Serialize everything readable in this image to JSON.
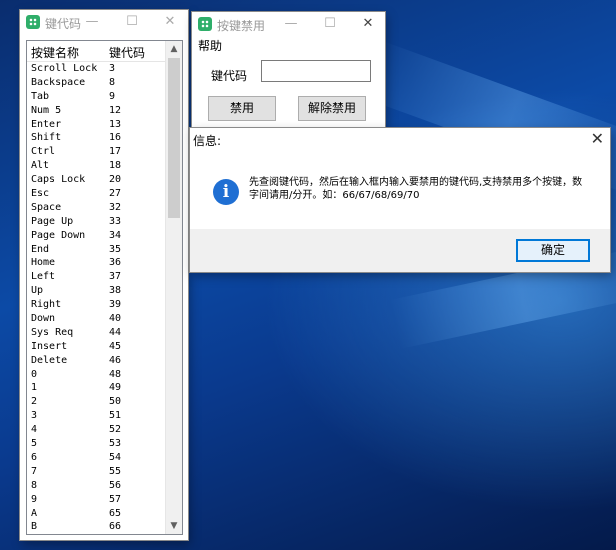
{
  "codes_window": {
    "title": "键代码",
    "minimize": "—",
    "maximize": "☐",
    "close": "✕",
    "columns": {
      "name": "按键名称",
      "code": "键代码"
    },
    "rows": [
      {
        "name": "Scroll Lock",
        "code": "3"
      },
      {
        "name": "Backspace",
        "code": "8"
      },
      {
        "name": "Tab",
        "code": "9"
      },
      {
        "name": "Num 5",
        "code": "12"
      },
      {
        "name": "Enter",
        "code": "13"
      },
      {
        "name": "Shift",
        "code": "16"
      },
      {
        "name": "Ctrl",
        "code": "17"
      },
      {
        "name": "Alt",
        "code": "18"
      },
      {
        "name": "Caps Lock",
        "code": "20"
      },
      {
        "name": "Esc",
        "code": "27"
      },
      {
        "name": "Space",
        "code": "32"
      },
      {
        "name": "Page Up",
        "code": "33"
      },
      {
        "name": "Page Down",
        "code": "34"
      },
      {
        "name": "End",
        "code": "35"
      },
      {
        "name": "Home",
        "code": "36"
      },
      {
        "name": "Left",
        "code": "37"
      },
      {
        "name": "Up",
        "code": "38"
      },
      {
        "name": "Right",
        "code": "39"
      },
      {
        "name": "Down",
        "code": "40"
      },
      {
        "name": "Sys Req",
        "code": "44"
      },
      {
        "name": "Insert",
        "code": "45"
      },
      {
        "name": "Delete",
        "code": "46"
      },
      {
        "name": "0",
        "code": "48"
      },
      {
        "name": "1",
        "code": "49"
      },
      {
        "name": "2",
        "code": "50"
      },
      {
        "name": "3",
        "code": "51"
      },
      {
        "name": "4",
        "code": "52"
      },
      {
        "name": "5",
        "code": "53"
      },
      {
        "name": "6",
        "code": "54"
      },
      {
        "name": "7",
        "code": "55"
      },
      {
        "name": "8",
        "code": "56"
      },
      {
        "name": "9",
        "code": "57"
      },
      {
        "name": "A",
        "code": "65"
      },
      {
        "name": "B",
        "code": "66"
      }
    ],
    "scroll_up": "▲",
    "scroll_down": "▼"
  },
  "block_window": {
    "title": "按键禁用",
    "minimize": "—",
    "maximize": "☐",
    "close": "✕",
    "menu_help": "帮助",
    "code_label": "键代码",
    "code_value": "",
    "disable_label": "禁用",
    "enable_label": "解除禁用"
  },
  "message_box": {
    "title": "信息:",
    "close": "✕",
    "icon_glyph": "i",
    "text": "先查阅键代码，然后在输入框内输入要禁用的键代码,支持禁用多个按键，数字间请用/分开。如：66/67/68/69/70",
    "ok_label": "确定"
  },
  "colors": {
    "accent": "#0078d7",
    "app_icon": "#2fae6a",
    "info_icon": "#1f6fd3"
  }
}
